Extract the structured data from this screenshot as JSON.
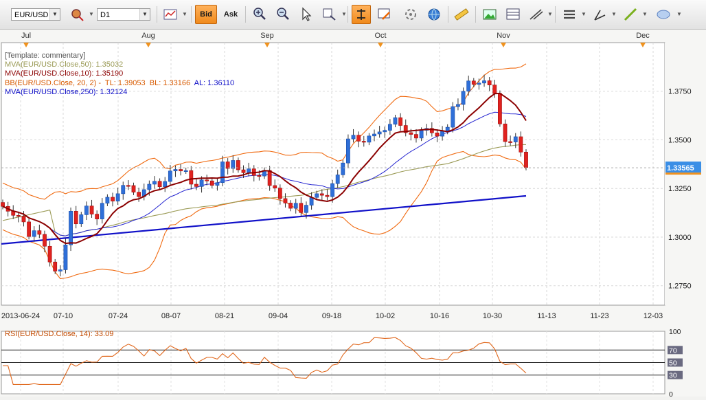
{
  "toolbar": {
    "symbol": "EUR/USD",
    "timeframe": "D1",
    "bid_label": "Bid",
    "ask_label": "Ask"
  },
  "legend": {
    "template": "[Template: commentary]",
    "ma50": "MVA(EUR/USD.Close,50): 1.35032",
    "ma10": "MVA(EUR/USD.Close,10): 1.35190",
    "bb_prefix": "BB(EUR/USD.Close, 20, 2) -",
    "bb_tl": "TL: 1.39053",
    "bb_bl": "BL: 1.33166",
    "bb_al": "AL: 1.36110",
    "ma250": "MVA(EUR/USD.Close,250): 1.32124"
  },
  "rsi_legend": "RSI(EUR/USD.Close, 14): 33.09",
  "colors": {
    "bull": "#2f6fd8",
    "bear": "#e0221f",
    "ma10": "#8b0000",
    "ma50": "#9a9a55",
    "ma250": "#1010c8",
    "bb": "#f06a10",
    "ma20": "#2525d0",
    "rsi": "#e0661a",
    "accent": "#f0921e",
    "current_price_bg": "#3a8ee6"
  },
  "chart_data": [
    {
      "type": "candlestick",
      "symbol": "EUR/USD",
      "period": "D1",
      "current_price": "1.33565",
      "y_ticks": [
        "1.3750",
        "1.3500",
        "1.3250",
        "1.3000",
        "1.2750"
      ],
      "x_ticks": [
        "2013-06-24",
        "07-10",
        "07-24",
        "08-07",
        "08-21",
        "09-04",
        "09-18",
        "10-02",
        "10-16",
        "10-30",
        "11-13",
        "11-23",
        "12-03"
      ],
      "month_labels": [
        "Jul",
        "Aug",
        "Sep",
        "Oct",
        "Nov",
        "Dec"
      ],
      "ylim": [
        1.265,
        1.4
      ],
      "approx_closes": [
        1.3158,
        1.3133,
        1.3112,
        1.3107,
        1.3078,
        1.3003,
        1.3033,
        1.3014,
        1.2953,
        1.2872,
        1.2825,
        1.2832,
        1.296,
        1.3133,
        1.3068,
        1.3115,
        1.316,
        1.3118,
        1.3093,
        1.3174,
        1.3205,
        1.3185,
        1.3223,
        1.3266,
        1.3265,
        1.3231,
        1.3208,
        1.3244,
        1.3272,
        1.3287,
        1.3259,
        1.3286,
        1.334,
        1.3348,
        1.334,
        1.3342,
        1.3272,
        1.326,
        1.3294,
        1.3289,
        1.3266,
        1.328,
        1.3387,
        1.3353,
        1.3394,
        1.3346,
        1.3331,
        1.3351,
        1.3317,
        1.3314,
        1.3343,
        1.3265,
        1.3252,
        1.3198,
        1.3175,
        1.3148,
        1.3174,
        1.3126,
        1.3164,
        1.3204,
        1.3223,
        1.3215,
        1.3208,
        1.3275,
        1.332,
        1.3381,
        1.3505,
        1.3524,
        1.3493,
        1.3488,
        1.352,
        1.353,
        1.3541,
        1.3549,
        1.358,
        1.3614,
        1.3574,
        1.3537,
        1.3528,
        1.3509,
        1.3549,
        1.3559,
        1.3536,
        1.3519,
        1.3544,
        1.3565,
        1.3671,
        1.3682,
        1.375,
        1.3803,
        1.3785,
        1.3792,
        1.3804,
        1.3782,
        1.3739,
        1.3582,
        1.3491,
        1.3489,
        1.3516,
        1.3437,
        1.3358
      ],
      "series": [
        {
          "name": "MVA(EUR/USD.Close,10)"
        },
        {
          "name": "MVA(EUR/USD.Close,50)"
        },
        {
          "name": "MVA(EUR/USD.Close,250)"
        },
        {
          "name": "BB(EUR/USD.Close, 20, 2)"
        }
      ]
    },
    {
      "type": "line",
      "title": "RSI(EUR/USD.Close, 14): 33.09",
      "y_ticks": [
        "100",
        "70",
        "50",
        "30",
        "0"
      ],
      "ylim": [
        0,
        100
      ],
      "last_value": 33.09
    }
  ]
}
